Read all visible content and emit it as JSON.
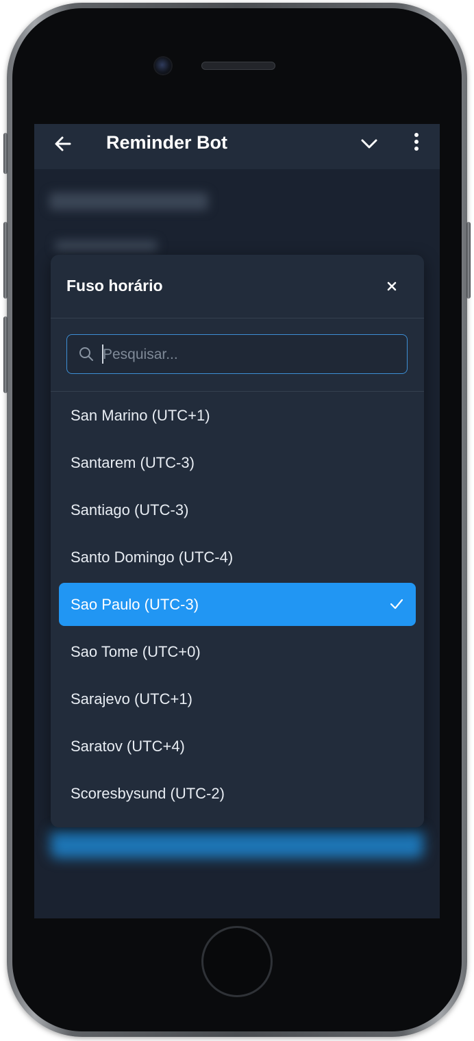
{
  "appbar": {
    "title": "Reminder Bot",
    "back_icon": "arrow-left-icon",
    "expand_icon": "chevron-down-icon",
    "menu_icon": "more-vertical-icon"
  },
  "dialog": {
    "title": "Fuso horário",
    "close_icon": "close-icon",
    "search": {
      "placeholder": "Pesquisar...",
      "value": "",
      "icon": "search-icon"
    },
    "selected_index": 4,
    "options": [
      {
        "label": "San Marino (UTC+1)"
      },
      {
        "label": "Santarem (UTC-3)"
      },
      {
        "label": "Santiago (UTC-3)"
      },
      {
        "label": "Santo Domingo (UTC-4)"
      },
      {
        "label": "Sao Paulo (UTC-3)"
      },
      {
        "label": "Sao Tome (UTC+0)"
      },
      {
        "label": "Sarajevo (UTC+1)"
      },
      {
        "label": "Saratov (UTC+4)"
      },
      {
        "label": "Scoresbysund (UTC-2)"
      }
    ]
  },
  "colors": {
    "accent": "#2196f3",
    "surface": "#222c3b",
    "background": "#1a2230"
  }
}
